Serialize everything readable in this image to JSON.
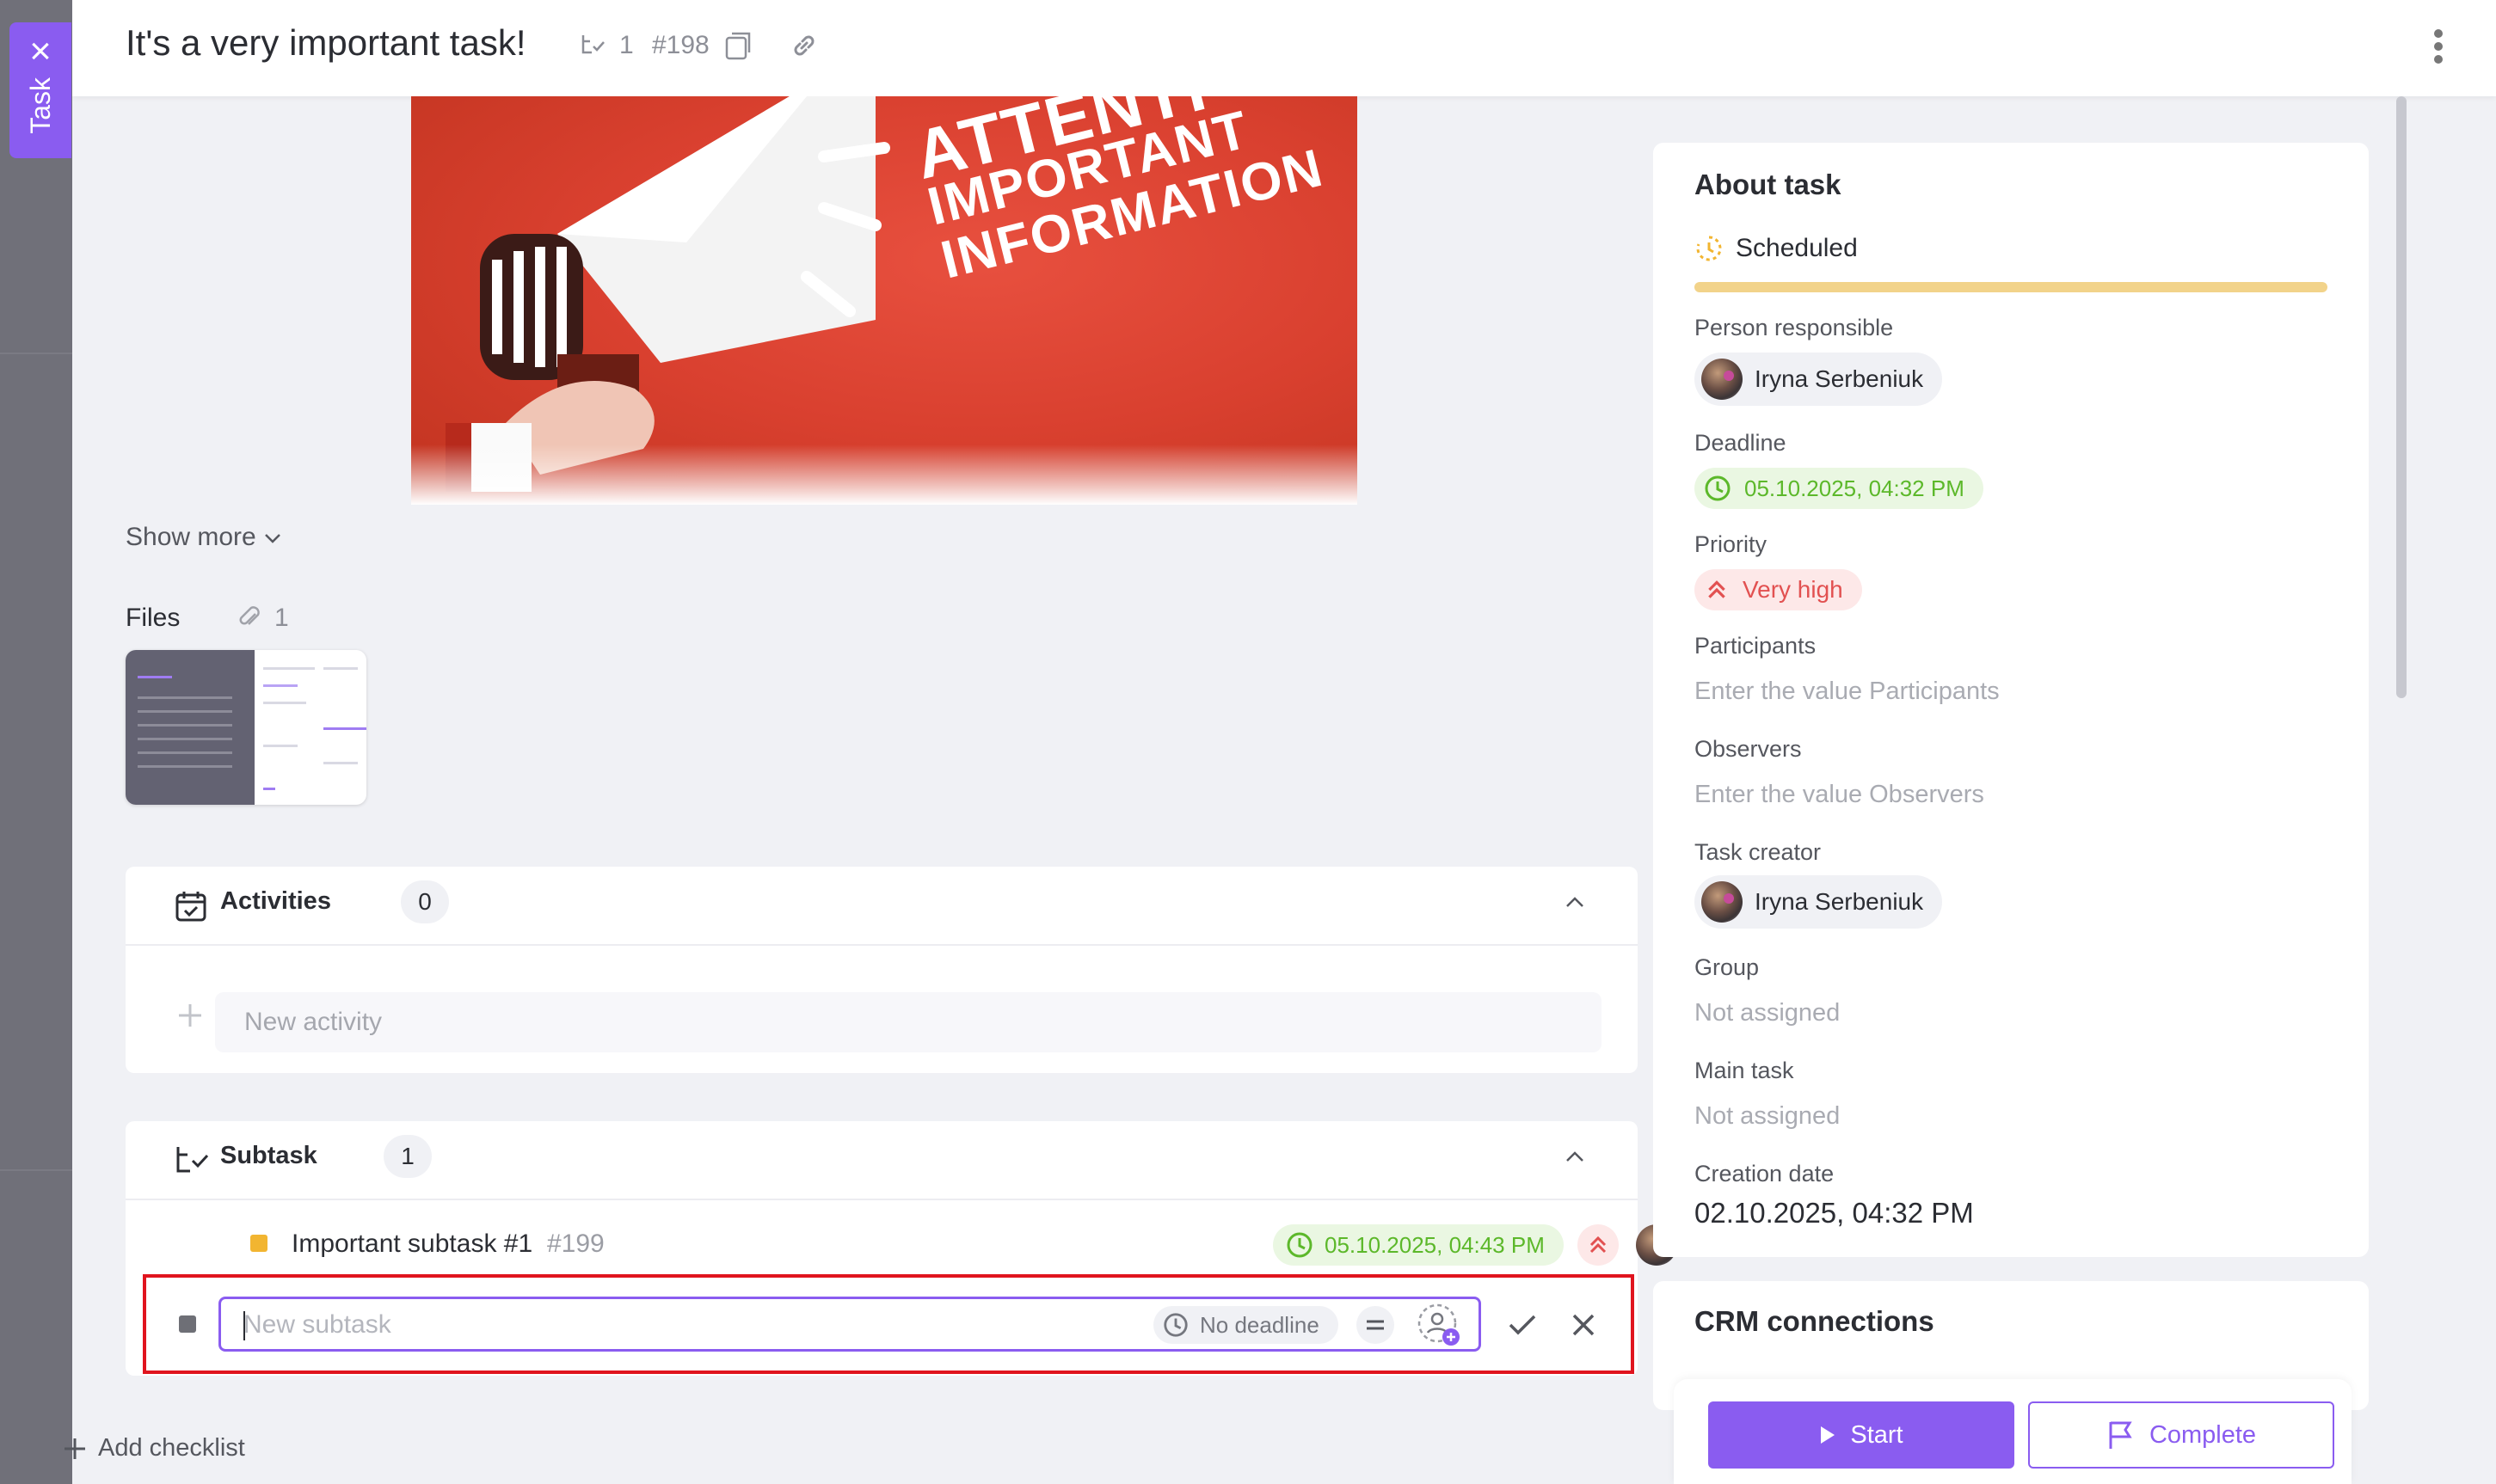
{
  "side_tab": {
    "label": "Task"
  },
  "header": {
    "title": "It's a very important task!",
    "subtask_count": "1",
    "task_id": "#198"
  },
  "hero": {
    "text_line1": "ATTENTI",
    "text_line2": "IMPORTANT",
    "text_line3": "INFORMATION"
  },
  "description": {
    "show_more": "Show more"
  },
  "files": {
    "label": "Files",
    "count": "1"
  },
  "activities": {
    "title": "Activities",
    "count": "0",
    "new_placeholder": "New activity"
  },
  "subtasks": {
    "title": "Subtask",
    "count": "1",
    "items": [
      {
        "name": "Important subtask #1",
        "id": "#199",
        "deadline": "05.10.2025, 04:43 PM",
        "status_color": "#f2b531"
      }
    ],
    "new_placeholder": "New subtask",
    "new_deadline": "No deadline"
  },
  "add_checklist": "Add checklist",
  "about": {
    "title": "About task",
    "status": "Scheduled",
    "person_responsible_label": "Person responsible",
    "person_responsible": "Iryna Serbeniuk",
    "deadline_label": "Deadline",
    "deadline": "05.10.2025, 04:32 PM",
    "priority_label": "Priority",
    "priority": "Very high",
    "participants_label": "Participants",
    "participants_placeholder": "Enter the value Participants",
    "observers_label": "Observers",
    "observers_placeholder": "Enter the value Observers",
    "creator_label": "Task creator",
    "creator": "Iryna Serbeniuk",
    "group_label": "Group",
    "group": "Not assigned",
    "main_task_label": "Main task",
    "main_task": "Not assigned",
    "creation_date_label": "Creation date",
    "creation_date": "02.10.2025, 04:32 PM"
  },
  "crm": {
    "title": "CRM connections"
  },
  "actions": {
    "start": "Start",
    "complete": "Complete"
  },
  "colors": {
    "accent": "#8a5cf0",
    "deadline_green": "#5cb82a",
    "priority_red": "#e25151",
    "status_yellow": "#f2d38a",
    "highlight_red": "#e0141e"
  }
}
